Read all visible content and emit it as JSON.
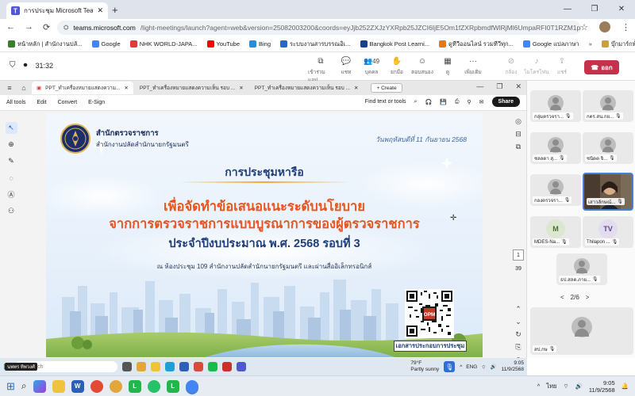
{
  "browser": {
    "tab_title": "การประชุม Microsoft Teams",
    "new_tab": "+",
    "url_domain": "teams.microsoft.com",
    "url_rest": "/light-meetings/launch?agent=web&version=25082003200&coords=eyJjb252ZXJzYXRpb25JZCI6IjE5Om1fZXRpbmdfWlRjMl6UmpaRFI0T1RZM1ppMDBZekF5TFRne...",
    "bookmarks": [
      {
        "label": "หน้าหลัก | สำนักงานปลั...",
        "color": "#3a7d2c"
      },
      {
        "label": "Google",
        "color": "#4285f4"
      },
      {
        "label": "NHK WORLD-JAPA...",
        "color": "#e03a3a"
      },
      {
        "label": "YouTube",
        "color": "#ff0000"
      },
      {
        "label": "Bing",
        "color": "#1f8fe0"
      },
      {
        "label": "ระบบงานสารบรรณอิเ...",
        "color": "#2a66c4"
      },
      {
        "label": "Bangkok Post Learni...",
        "color": "#1a3f8a"
      },
      {
        "label": "ดูทีวีออนไลน์ รวมทีวีทุก...",
        "color": "#e07a1a"
      },
      {
        "label": "Google แปลภาษา",
        "color": "#4285f4"
      }
    ],
    "bookmarks_more": "»",
    "all_bookmarks": "บุ๊กมาร์กทั้งหมด"
  },
  "teams": {
    "timer": "31:32",
    "tools": [
      {
        "icon": "chat-bubble-icon",
        "glyph": "💬",
        "label": "แชท",
        "dim": false
      },
      {
        "icon": "people-icon",
        "glyph": "👥",
        "label": "บุคคล",
        "count": "49",
        "dim": false
      },
      {
        "icon": "raise-hand-icon",
        "glyph": "✋",
        "label": "ยกมือ",
        "dim": false
      },
      {
        "icon": "reaction-icon",
        "glyph": "☺",
        "label": "ตอบสนอง",
        "dim": false
      },
      {
        "icon": "grid-view-icon",
        "glyph": "▦",
        "label": "ดู",
        "dim": false
      },
      {
        "icon": "more-icon",
        "glyph": "···",
        "label": "เพิ่มเติม",
        "dim": false
      },
      {
        "icon": "camera-off-icon",
        "glyph": "🚫",
        "label": "กล้อง",
        "dim": true
      },
      {
        "icon": "mic-off-icon",
        "glyph": "🎙",
        "label": "ไมโครโฟน",
        "dim": true
      },
      {
        "icon": "share-tray-icon",
        "glyph": "⬆",
        "label": "แชร์",
        "dim": true
      }
    ],
    "first_tool": {
      "icon": "open-in-app-icon",
      "glyph": "⧉",
      "label": "เข้าร่วมแอป"
    },
    "leave_label": "ออก"
  },
  "pdf": {
    "tabs": [
      "PPT_ทำเครื่องหมายแสดงความ...",
      "PPT_ทำเครื่องหมายแสดงความเห็น รอบ ...",
      "PPT_ทำเครื่องหมายแสดงความเห็น รอบ ..."
    ],
    "create_label": "+ Create",
    "menu": [
      "All tools",
      "Edit",
      "Convert",
      "E-Sign"
    ],
    "find_label": "Find text or tools",
    "share_label": "Share",
    "page_number": "1",
    "page_count": "39"
  },
  "slide": {
    "org_line1": "สำนักตรวจราชการ",
    "org_line2": "สำนักงานปลัดสำนักนายกรัฐมนตรี",
    "date": "วันพฤหัสบดีที่ 11 กันยายน 2568",
    "meeting": "การประชุมหารือ",
    "heading1": "เพื่อจัดทำข้อเสนอแนะระดับนโยบาย",
    "heading2": "จากการตรวจราชการแบบบูรณาการของผู้ตรวจราชการ",
    "heading3": "ประจำปีงบประมาณ พ.ศ. 2568 รอบที่ 3",
    "venue": "ณ ห้องประชุม 109 สำนักงานปลัดสำนักนายกรัฐมนตรี และผ่านสื่ออิเล็กทรอนิกส์",
    "qr_center": "OPM",
    "qr_label": "เอกสารประกอบการประชุม"
  },
  "participants": {
    "tiles": [
      {
        "name": "กลุ่มตรวจรา...",
        "kind": "avatar"
      },
      {
        "name": "กตร.สน.กย...",
        "kind": "avatar"
      },
      {
        "name": "ชลลดา สุ...",
        "kind": "avatar"
      },
      {
        "name": "ชนิตต จิ...",
        "kind": "avatar"
      },
      {
        "name": "กองตรวจรา...",
        "kind": "avatar"
      },
      {
        "name": "เสาวลักษณ์...",
        "kind": "video"
      },
      {
        "name": "MDES-Na...",
        "kind": "initials",
        "initials": "M",
        "color": "#dbe8cf",
        "fg": "#4d6b35"
      },
      {
        "name": "Thilapon ...",
        "kind": "initials",
        "initials": "TV",
        "color": "#e3dbef",
        "fg": "#5d4a80"
      },
      {
        "name": "ธป.สลด.ภาย...",
        "kind": "avatar"
      }
    ],
    "page": "2/6",
    "prev": "<",
    "next": ">",
    "bottom_name": "สป.กษ"
  },
  "inner_taskbar": {
    "search_placeholder": "Search",
    "user_tag": "นพพร ทิพวงศ์",
    "temp": "79°F",
    "weather": "Partly sunny",
    "lang": "ENG",
    "time": "9:05",
    "date": "11/9/2568"
  },
  "taskbar": {
    "lang": "ไทย",
    "time": "9:05",
    "date": "11/9/2568"
  }
}
